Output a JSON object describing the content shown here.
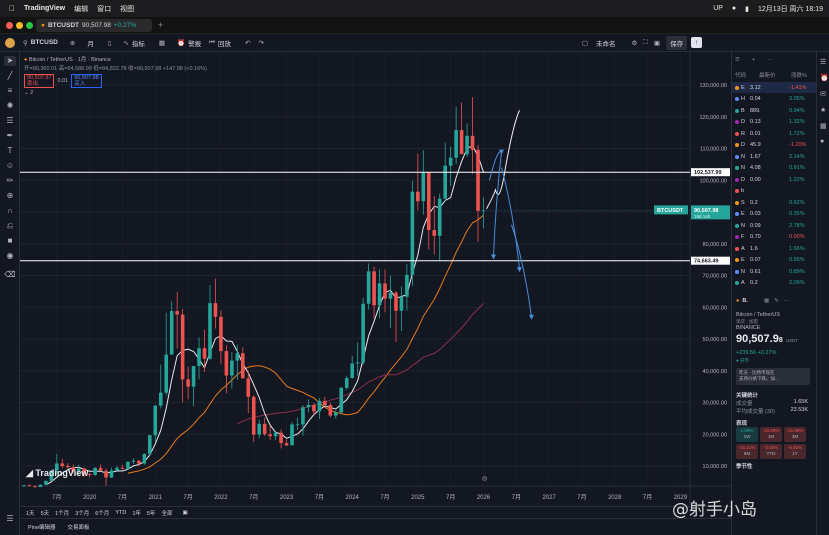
{
  "menubar": {
    "apple": "",
    "app": "TradingView",
    "items": [
      "编辑",
      "窗口",
      "视图"
    ],
    "status": [
      "UP"
    ],
    "datetime": "12月13日 周六 18:19"
  },
  "tab": {
    "symbol": "BTCUSDT",
    "price": "90,507.98",
    "change": "+0.27%"
  },
  "toolbar": {
    "symbol": "BTCUSD",
    "interval": "月",
    "indicators": "指标",
    "alert": "警报",
    "replay": "回放",
    "layout_name": "未命名",
    "save": "保存"
  },
  "legend": {
    "title": "Bitcoin / TetherUS · 1月 · Binance",
    "ohlc": "开=90,360.01 高=94,588.99 低=84,822.78 收=90,507.98 +147.98 (+0.16%)",
    "sell": "90,507.97",
    "sell_label": "卖出",
    "spread": "0.01",
    "buy": "90,507.98",
    "buy_label": "买入",
    "extra": "2"
  },
  "chart_data": {
    "type": "candlestick",
    "symbol": "BTCUSDT",
    "interval": "1M",
    "y_axis_ticks": [
      130000,
      120000,
      110000,
      100000,
      90000,
      80000,
      70000,
      60000,
      50000,
      40000,
      30000,
      20000,
      10000
    ],
    "y_axis_labels": [
      "130,000.00",
      "120,000.00",
      "110,000.00",
      "100,000.00",
      "90,000.00",
      "80,000.00",
      "70,000.00",
      "60,000.00",
      "50,000.00",
      "40,000.00",
      "30,000.00",
      "20,000.00",
      "10,000.00"
    ],
    "x_axis_labels": [
      "7月",
      "2020",
      "7月",
      "2021",
      "7月",
      "2022",
      "7月",
      "2023",
      "7月",
      "2024",
      "7月",
      "2025",
      "7月",
      "2026",
      "7月",
      "2027",
      "7月",
      "2028",
      "7月",
      "2029"
    ],
    "horizontal_lines": [
      {
        "value": 102537.99,
        "label": "102,537.99"
      },
      {
        "value": 74663.49,
        "label": "74,663.49"
      }
    ],
    "last_price": {
      "value": 90507.98,
      "label": "90,507.98",
      "symbol": "BTCUSDT",
      "countdown": "18d 14h"
    },
    "up_color": "#26a69a",
    "down_color": "#ef5350",
    "candles": [
      [
        3800,
        4100,
        3400,
        3900
      ],
      [
        3900,
        4200,
        3500,
        3700
      ],
      [
        3700,
        3800,
        3100,
        3400
      ],
      [
        3400,
        4200,
        3400,
        4100
      ],
      [
        4100,
        5500,
        4000,
        5300
      ],
      [
        5300,
        8800,
        5200,
        8600
      ],
      [
        8600,
        13800,
        7500,
        10800
      ],
      [
        10800,
        12300,
        9300,
        10000
      ],
      [
        10000,
        10900,
        9300,
        9600
      ],
      [
        9600,
        10500,
        7700,
        8300
      ],
      [
        8300,
        10400,
        7300,
        9200
      ],
      [
        9200,
        9500,
        6500,
        7500
      ],
      [
        7500,
        7700,
        6400,
        7200
      ],
      [
        7200,
        9600,
        6900,
        9400
      ],
      [
        9400,
        10500,
        8500,
        8500
      ],
      [
        8500,
        9200,
        3800,
        6400
      ],
      [
        6400,
        9500,
        6200,
        8600
      ],
      [
        8600,
        10000,
        8100,
        9450
      ],
      [
        9450,
        10400,
        8900,
        9140
      ],
      [
        9140,
        11400,
        8900,
        11350
      ],
      [
        11350,
        12500,
        10600,
        11650
      ],
      [
        11650,
        12000,
        10000,
        10780
      ],
      [
        10780,
        14000,
        10400,
        13800
      ],
      [
        13800,
        19800,
        13200,
        19700
      ],
      [
        19700,
        29300,
        17600,
        29000
      ],
      [
        29000,
        41900,
        28100,
        33100
      ],
      [
        33100,
        58300,
        32200,
        45100
      ],
      [
        45100,
        61800,
        45000,
        58800
      ],
      [
        58800,
        64800,
        47000,
        57700
      ],
      [
        57700,
        59500,
        30000,
        37300
      ],
      [
        37300,
        41300,
        31000,
        35000
      ],
      [
        35000,
        36600,
        28800,
        41500
      ],
      [
        41500,
        50500,
        37300,
        47100
      ],
      [
        47100,
        52900,
        39600,
        43800
      ],
      [
        43800,
        67000,
        43300,
        61300
      ],
      [
        61300,
        69000,
        53300,
        57000
      ],
      [
        57000,
        59000,
        42000,
        46200
      ],
      [
        46200,
        48000,
        32900,
        38500
      ],
      [
        38500,
        45800,
        34300,
        43200
      ],
      [
        43200,
        48200,
        37200,
        45500
      ],
      [
        45500,
        47400,
        37600,
        37600
      ],
      [
        37600,
        40000,
        26700,
        31800
      ],
      [
        31800,
        32300,
        17600,
        19900
      ],
      [
        19900,
        24600,
        18700,
        23300
      ],
      [
        23300,
        25200,
        19500,
        20000
      ],
      [
        20000,
        22800,
        18100,
        19400
      ],
      [
        19400,
        21000,
        18200,
        20500
      ],
      [
        20500,
        21500,
        15500,
        17200
      ],
      [
        17200,
        18400,
        16300,
        16500
      ],
      [
        16500,
        23900,
        16500,
        23100
      ],
      [
        23100,
        25300,
        21300,
        23100
      ],
      [
        23100,
        29200,
        19500,
        28500
      ],
      [
        28500,
        31000,
        26900,
        29200
      ],
      [
        29200,
        29800,
        25800,
        27200
      ],
      [
        27200,
        31400,
        24800,
        30500
      ],
      [
        30500,
        31800,
        28800,
        29200
      ],
      [
        29200,
        30000,
        25300,
        25900
      ],
      [
        25900,
        27500,
        24900,
        26900
      ],
      [
        26900,
        35000,
        26500,
        34600
      ],
      [
        34600,
        38400,
        34000,
        37700
      ],
      [
        37700,
        44700,
        37600,
        42300
      ],
      [
        42300,
        48900,
        38500,
        42600
      ],
      [
        42600,
        63000,
        41900,
        61100
      ],
      [
        61100,
        73800,
        59300,
        71300
      ],
      [
        71300,
        72800,
        56500,
        60600
      ],
      [
        60600,
        71900,
        56500,
        67500
      ],
      [
        67500,
        71900,
        58400,
        62700
      ],
      [
        62700,
        70000,
        53500,
        64600
      ],
      [
        64600,
        65100,
        49000,
        58900
      ],
      [
        58900,
        66500,
        52500,
        63300
      ],
      [
        63300,
        73600,
        58900,
        70200
      ],
      [
        70200,
        99800,
        66800,
        96400
      ],
      [
        96400,
        108300,
        90500,
        93400
      ],
      [
        93400,
        109500,
        89200,
        102400
      ],
      [
        102400,
        102500,
        78200,
        84300
      ],
      [
        84300,
        95000,
        76600,
        82500
      ],
      [
        82500,
        95800,
        74500,
        94200
      ],
      [
        94200,
        111900,
        93400,
        104600
      ],
      [
        104600,
        110500,
        98200,
        107100
      ],
      [
        107100,
        123200,
        105100,
        115800
      ],
      [
        115800,
        124500,
        108700,
        108200
      ],
      [
        108200,
        117900,
        107300,
        114000
      ],
      [
        114000,
        126200,
        102000,
        109600
      ],
      [
        109600,
        111200,
        80600,
        90360
      ],
      [
        90360,
        94600,
        84800,
        90508
      ]
    ],
    "projection": {
      "white_path": [
        [
          102000,
          "a"
        ],
        [
          91000,
          "b"
        ],
        [
          96000,
          "c"
        ],
        [
          120000,
          "d"
        ]
      ],
      "blue_paths": 3
    }
  },
  "rightpanel": {
    "watchlist_header": [
      "代码",
      "最新价",
      "涨跌%"
    ],
    "watchlist": [
      {
        "sym": "E",
        "price": "3.12",
        "chg": "-1.41%",
        "neg": true
      },
      {
        "sym": "H",
        "price": "0.04",
        "chg": "3.05%",
        "neg": false
      },
      {
        "sym": "B",
        "price": "889.",
        "chg": "0.94%",
        "neg": false
      },
      {
        "sym": "D",
        "price": "0.13",
        "chg": "1.32%",
        "neg": false
      },
      {
        "sym": "R",
        "price": "0.01",
        "chg": "1.72%",
        "neg": false
      },
      {
        "sym": "D",
        "price": "45.9",
        "chg": "-1.20%",
        "neg": true
      },
      {
        "sym": "N",
        "price": "1.67",
        "chg": "2.14%",
        "neg": false
      },
      {
        "sym": "N",
        "price": "4.08",
        "chg": "0.91%",
        "neg": false
      },
      {
        "sym": "D",
        "price": "0.00",
        "chg": "1.22%",
        "neg": false
      },
      {
        "sym": "b",
        "price": "",
        "chg": "",
        "neg": false
      },
      {
        "sym": "S",
        "price": "0.2",
        "chg": "0.62%",
        "neg": false
      },
      {
        "sym": "E",
        "price": "0.03",
        "chg": "0.35%",
        "neg": false
      },
      {
        "sym": "N",
        "price": "0.09",
        "chg": "2.78%",
        "neg": false
      },
      {
        "sym": "F",
        "price": "0.70",
        "chg": "0.00%",
        "neg": true
      },
      {
        "sym": "A",
        "price": "1.6",
        "chg": "1.66%",
        "neg": false
      },
      {
        "sym": "E",
        "price": "0.07",
        "chg": "0.55%",
        "neg": false
      },
      {
        "sym": "N",
        "price": "0.61",
        "chg": "0.89%",
        "neg": false
      },
      {
        "sym": "A",
        "price": "0.2",
        "chg": "2.09%",
        "neg": false
      }
    ],
    "details_symbol": "B.",
    "details_name": "Bitcoin / TetherUS",
    "details_meta": "现货 · 加密",
    "exchange": "BINANCE",
    "big_price": "90,507.9",
    "big_price_tail": "8",
    "currency": "USDT",
    "change": "+239.56",
    "change_pct": "+0.27%",
    "market_status": "开市",
    "news_line1": "昨天 · 比特币现在",
    "news_line2": "支持价格下跌。加...",
    "stats_title": "关键统计",
    "volume_label": "成交量",
    "volume_value": "1.65K",
    "avg_volume_label": "平均成交量 (30)",
    "avg_volume_value": "23.53K",
    "perf_title": "表现",
    "perf": [
      {
        "v": "1.09%",
        "p": "1W",
        "neg": false
      },
      {
        "v": "-10.59%",
        "p": "1M",
        "neg": true
      },
      {
        "v": "-21.68%",
        "p": "3M",
        "neg": true
      },
      {
        "v": "-16.21%",
        "p": "6M",
        "neg": true
      },
      {
        "v": "-3.50%",
        "p": "YTD",
        "neg": true
      },
      {
        "v": "-6.92%",
        "p": "1Y",
        "neg": true
      }
    ],
    "seasonal": "季节性"
  },
  "bottombar": {
    "ranges": [
      "1天",
      "5天",
      "1个月",
      "3个月",
      "6个月",
      "YTD",
      "1年",
      "5年",
      "全部"
    ]
  },
  "panelbar": {
    "items": [
      "Pine编辑器",
      "交易面板"
    ]
  },
  "watermark": {
    "text": "@射手小岛"
  }
}
